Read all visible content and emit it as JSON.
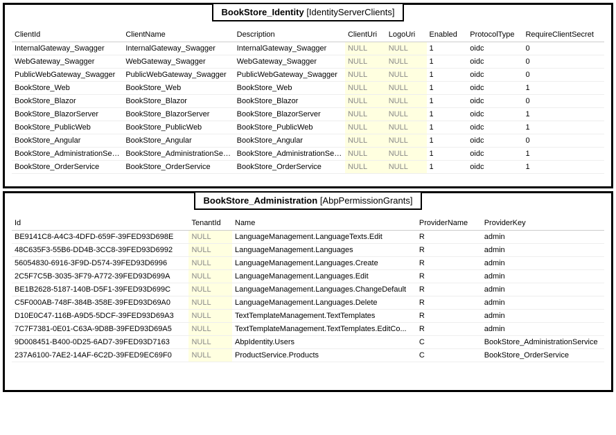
{
  "panel1": {
    "title_main": "BookStore_Identity",
    "title_bracket": "[IdentityServerClients]",
    "columns": [
      "ClientId",
      "ClientName",
      "Description",
      "ClientUri",
      "LogoUri",
      "Enabled",
      "ProtocolType",
      "RequireClientSecret"
    ],
    "rows": [
      {
        "ClientId": "InternalGateway_Swagger",
        "ClientName": "InternalGateway_Swagger",
        "Description": "InternalGateway_Swagger",
        "ClientUri": "NULL",
        "LogoUri": "NULL",
        "Enabled": "1",
        "ProtocolType": "oidc",
        "RequireClientSecret": "0"
      },
      {
        "ClientId": "WebGateway_Swagger",
        "ClientName": "WebGateway_Swagger",
        "Description": "WebGateway_Swagger",
        "ClientUri": "NULL",
        "LogoUri": "NULL",
        "Enabled": "1",
        "ProtocolType": "oidc",
        "RequireClientSecret": "0"
      },
      {
        "ClientId": "PublicWebGateway_Swagger",
        "ClientName": "PublicWebGateway_Swagger",
        "Description": "PublicWebGateway_Swagger",
        "ClientUri": "NULL",
        "LogoUri": "NULL",
        "Enabled": "1",
        "ProtocolType": "oidc",
        "RequireClientSecret": "0"
      },
      {
        "ClientId": "BookStore_Web",
        "ClientName": "BookStore_Web",
        "Description": "BookStore_Web",
        "ClientUri": "NULL",
        "LogoUri": "NULL",
        "Enabled": "1",
        "ProtocolType": "oidc",
        "RequireClientSecret": "1"
      },
      {
        "ClientId": "BookStore_Blazor",
        "ClientName": "BookStore_Blazor",
        "Description": "BookStore_Blazor",
        "ClientUri": "NULL",
        "LogoUri": "NULL",
        "Enabled": "1",
        "ProtocolType": "oidc",
        "RequireClientSecret": "0"
      },
      {
        "ClientId": "BookStore_BlazorServer",
        "ClientName": "BookStore_BlazorServer",
        "Description": "BookStore_BlazorServer",
        "ClientUri": "NULL",
        "LogoUri": "NULL",
        "Enabled": "1",
        "ProtocolType": "oidc",
        "RequireClientSecret": "1"
      },
      {
        "ClientId": "BookStore_PublicWeb",
        "ClientName": "BookStore_PublicWeb",
        "Description": "BookStore_PublicWeb",
        "ClientUri": "NULL",
        "LogoUri": "NULL",
        "Enabled": "1",
        "ProtocolType": "oidc",
        "RequireClientSecret": "1"
      },
      {
        "ClientId": "BookStore_Angular",
        "ClientName": "BookStore_Angular",
        "Description": "BookStore_Angular",
        "ClientUri": "NULL",
        "LogoUri": "NULL",
        "Enabled": "1",
        "ProtocolType": "oidc",
        "RequireClientSecret": "0"
      },
      {
        "ClientId": "BookStore_AdministrationService",
        "ClientName": "BookStore_AdministrationService",
        "Description": "BookStore_AdministrationService",
        "ClientUri": "NULL",
        "LogoUri": "NULL",
        "Enabled": "1",
        "ProtocolType": "oidc",
        "RequireClientSecret": "1"
      },
      {
        "ClientId": "BookStore_OrderService",
        "ClientName": "BookStore_OrderService",
        "Description": "BookStore_OrderService",
        "ClientUri": "NULL",
        "LogoUri": "NULL",
        "Enabled": "1",
        "ProtocolType": "oidc",
        "RequireClientSecret": "1"
      }
    ]
  },
  "panel2": {
    "title_main": "BookStore_Administration",
    "title_bracket": "[AbpPermissionGrants]",
    "columns": [
      "Id",
      "TenantId",
      "Name",
      "ProviderName",
      "ProviderKey"
    ],
    "rows": [
      {
        "Id": "BE9141C8-A4C3-4DFD-659F-39FED93D698E",
        "TenantId": "NULL",
        "Name": "LanguageManagement.LanguageTexts.Edit",
        "ProviderName": "R",
        "ProviderKey": "admin"
      },
      {
        "Id": "48C635F3-55B6-DD4B-3CC8-39FED93D6992",
        "TenantId": "NULL",
        "Name": "LanguageManagement.Languages",
        "ProviderName": "R",
        "ProviderKey": "admin"
      },
      {
        "Id": "56054830-6916-3F9D-D574-39FED93D6996",
        "TenantId": "NULL",
        "Name": "LanguageManagement.Languages.Create",
        "ProviderName": "R",
        "ProviderKey": "admin"
      },
      {
        "Id": "2C5F7C5B-3035-3F79-A772-39FED93D699A",
        "TenantId": "NULL",
        "Name": "LanguageManagement.Languages.Edit",
        "ProviderName": "R",
        "ProviderKey": "admin"
      },
      {
        "Id": "BE1B2628-5187-140B-D5F1-39FED93D699C",
        "TenantId": "NULL",
        "Name": "LanguageManagement.Languages.ChangeDefault",
        "ProviderName": "R",
        "ProviderKey": "admin"
      },
      {
        "Id": "C5F000AB-748F-384B-358E-39FED93D69A0",
        "TenantId": "NULL",
        "Name": "LanguageManagement.Languages.Delete",
        "ProviderName": "R",
        "ProviderKey": "admin"
      },
      {
        "Id": "D10E0C47-116B-A9D5-5DCF-39FED93D69A3",
        "TenantId": "NULL",
        "Name": "TextTemplateManagement.TextTemplates",
        "ProviderName": "R",
        "ProviderKey": "admin"
      },
      {
        "Id": "7C7F7381-0E01-C63A-9D8B-39FED93D69A5",
        "TenantId": "NULL",
        "Name": "TextTemplateManagement.TextTemplates.EditCo...",
        "ProviderName": "R",
        "ProviderKey": "admin"
      },
      {
        "Id": "9D008451-B400-0D25-6AD7-39FED93D7163",
        "TenantId": "NULL",
        "Name": "AbpIdentity.Users",
        "ProviderName": "C",
        "ProviderKey": "BookStore_AdministrationService"
      },
      {
        "Id": "237A6100-7AE2-14AF-6C2D-39FED9EC69F0",
        "TenantId": "NULL",
        "Name": "ProductService.Products",
        "ProviderName": "C",
        "ProviderKey": "BookStore_OrderService"
      }
    ]
  }
}
